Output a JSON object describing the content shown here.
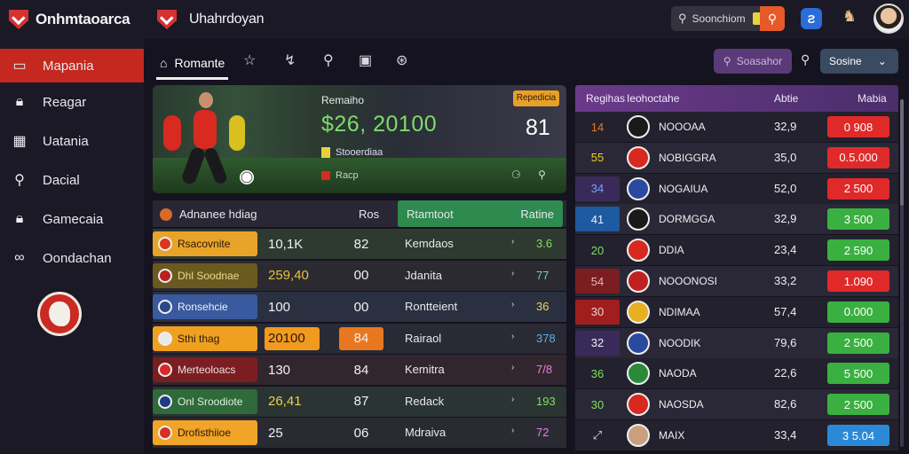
{
  "app": {
    "title": "Onhmtaoarca",
    "subtitle": "Uhahrdoyan"
  },
  "topbar": {
    "search_label": "Soonchiom",
    "search_icon": "search-icon",
    "avatar_icon": "avatar-icon"
  },
  "sidebar": {
    "items": [
      {
        "label": "Mapania",
        "icon": "flag-icon",
        "active": true
      },
      {
        "label": "Reagar",
        "icon": "lock-icon",
        "active": false
      },
      {
        "label": "Uatania",
        "icon": "grid-icon",
        "active": false
      },
      {
        "label": "Dacial",
        "icon": "search-icon",
        "active": false
      },
      {
        "label": "Gamecaia",
        "icon": "lock-icon",
        "active": false
      },
      {
        "label": "Oondachan",
        "icon": "link-icon",
        "active": false
      }
    ]
  },
  "toolbar": {
    "home_label": "Romante",
    "filter_label": "Soasahor",
    "status_label": "Sosine",
    "status_caret": "⌄"
  },
  "hero": {
    "label": "Remaiho",
    "amount": "$26, 20100",
    "badge": "Repedicia",
    "score": "81",
    "tag_text": "Stooerdiaa",
    "sub_text": "Racp",
    "controls": "⚆ ⚲"
  },
  "left_table": {
    "header_title": "Adnanee hdiag",
    "header_col2": "Ros",
    "header_col3": "Rtamtoot",
    "header_col4": "Ratine",
    "rows": [
      {
        "name": "Rsacovnite",
        "v1": "10,1K",
        "v2": "82",
        "team": "Kemdaos",
        "stat": "3.6",
        "name_bg": "#e8a428",
        "name_color": "#2a1a08",
        "v1_bg": "transparent",
        "v1_color": "#f0f0f4",
        "v2_bg": "transparent",
        "stat_color": "#7ee05a",
        "row_bg": "#2e3a30",
        "crest": "#d8381e"
      },
      {
        "name": "Dhl Soodnae",
        "v1": "259,40",
        "v2": "00",
        "team": "Jdanita",
        "stat": "77",
        "name_bg": "#6a5a20",
        "name_color": "#ecd890",
        "v1_bg": "transparent",
        "v1_color": "#e8c040",
        "v2_bg": "transparent",
        "stat_color": "#58d8d8",
        "row_bg": "#2a2a30",
        "crest": "#b8201e"
      },
      {
        "name": "Ronsehcie",
        "v1": "100",
        "v2": "00",
        "team": "Rontteient",
        "stat": "36",
        "name_bg": "#3a5aa0",
        "name_color": "#f0f0f8",
        "v1_bg": "transparent",
        "v1_color": "#f0f0f4",
        "v2_bg": "transparent",
        "stat_color": "#e8d850",
        "row_bg": "#2a3040",
        "crest": "#2a4a8a"
      },
      {
        "name": "Sthi thag",
        "v1": "20100",
        "v2": "84",
        "team": "Rairaol",
        "stat": "378",
        "name_bg": "#f0a020",
        "name_color": "#2a1808",
        "v1_bg": "#f09a20",
        "v1_color": "#2a1808",
        "v2_bg": "#e87820",
        "stat_color": "#58b0f0",
        "row_bg": "#2a2a34",
        "crest": "#e8e8e8"
      },
      {
        "name": "Merteoloacs",
        "v1": "130",
        "v2": "84",
        "team": "Kemitra",
        "stat": "7/8",
        "name_bg": "#7a1e22",
        "name_color": "#f0dede",
        "v1_bg": "transparent",
        "v1_color": "#f0f0f4",
        "v2_bg": "transparent",
        "stat_color": "#e880e0",
        "row_bg": "#32262e",
        "crest": "#d82828"
      },
      {
        "name": "Onl Sroodiote",
        "v1": "26,41",
        "v2": "87",
        "team": "Redack",
        "stat": "193",
        "name_bg": "#2e6a3a",
        "name_color": "#e0f0e0",
        "v1_bg": "transparent",
        "v1_color": "#e8d050",
        "v2_bg": "transparent",
        "stat_color": "#7ee05a",
        "row_bg": "#2a3432",
        "crest": "#1e3a8a"
      },
      {
        "name": "Drofisthiioe",
        "v1": "25",
        "v2": "06",
        "team": "Mdraiva",
        "stat": "72",
        "name_bg": "#f0a428",
        "name_color": "#2a1808",
        "v1_bg": "transparent",
        "v1_color": "#f0f0f4",
        "v2_bg": "transparent",
        "stat_color": "#e880e0",
        "row_bg": "#2a2a32",
        "crest": "#d83020"
      }
    ]
  },
  "right_table": {
    "header_rank": "Regihas",
    "header_name": "Ieohoctahe",
    "header_odd": "Abtie",
    "header_btn": "Mabia",
    "rows": [
      {
        "rank": "14",
        "name": "NOOOAA",
        "odd": "32,9",
        "btn": "0 908",
        "rk_bg": "transparent",
        "rk_color": "#e87828",
        "btn_bg": "#e02a2a",
        "badge": "#1a1a1a"
      },
      {
        "rank": "55",
        "name": "NOBIGGRA",
        "odd": "35,0",
        "btn": "0.5.000",
        "rk_bg": "transparent",
        "rk_color": "#e8d030",
        "btn_bg": "#e02a2a",
        "badge": "#d82820"
      },
      {
        "rank": "34",
        "name": "NOGAIUA",
        "odd": "52,0",
        "btn": "2 500",
        "rk_bg": "#3a2a5a",
        "rk_color": "#7aa0f0",
        "btn_bg": "#e02a2a",
        "badge": "#2a4aa0"
      },
      {
        "rank": "41",
        "name": "DORMGGA",
        "odd": "32,9",
        "btn": "3 500",
        "rk_bg": "#1e5aa0",
        "rk_color": "#f0f0f8",
        "btn_bg": "#3ab040",
        "badge": "#1a1a1a"
      },
      {
        "rank": "20",
        "name": "DDIA",
        "odd": "23,4",
        "btn": "2 590",
        "rk_bg": "transparent",
        "rk_color": "#7ee05a",
        "btn_bg": "#3ab040",
        "badge": "#d82820"
      },
      {
        "rank": "54",
        "name": "NOOONOSI",
        "odd": "33,2",
        "btn": "1.090",
        "rk_bg": "#7a1e22",
        "rk_color": "#f0b0b0",
        "btn_bg": "#e02a2a",
        "badge": "#c02020"
      },
      {
        "rank": "30",
        "name": "NDIMAA",
        "odd": "57,4",
        "btn": "0.000",
        "rk_bg": "#a01e1e",
        "rk_color": "#f0d0d0",
        "btn_bg": "#3ab040",
        "badge": "#e8b020"
      },
      {
        "rank": "32",
        "name": "NOODIK",
        "odd": "79,6",
        "btn": "2 500",
        "rk_bg": "#3a2a5a",
        "rk_color": "#f0f0f8",
        "btn_bg": "#3ab040",
        "badge": "#2a4aa0"
      },
      {
        "rank": "36",
        "name": "NAODA",
        "odd": "22,6",
        "btn": "5 500",
        "rk_bg": "transparent",
        "rk_color": "#7ee05a",
        "btn_bg": "#3ab040",
        "badge": "#2a8a3a"
      },
      {
        "rank": "30",
        "name": "NAOSDA",
        "odd": "82,6",
        "btn": "2 500",
        "rk_bg": "transparent",
        "rk_color": "#7ee05a",
        "btn_bg": "#3ab040",
        "badge": "#d82820"
      },
      {
        "rank": "⤢",
        "name": "MAIX",
        "odd": "33,4",
        "btn": "3 5.04",
        "rk_bg": "transparent",
        "rk_color": "#ddd",
        "btn_bg": "#2a8ad8",
        "badge": "#c8a080"
      }
    ]
  }
}
